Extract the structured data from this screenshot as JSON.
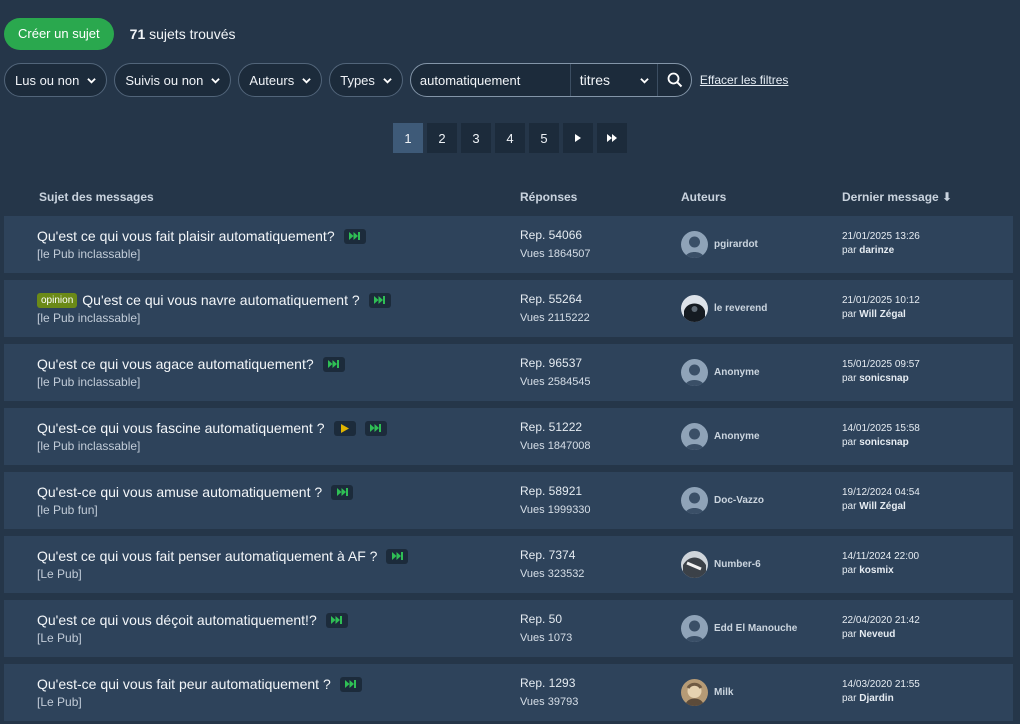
{
  "toolbar": {
    "create_label": "Créer un sujet",
    "count_number": "71",
    "count_suffix": "sujets trouvés"
  },
  "filters": {
    "items": [
      "Lus ou non",
      "Suivis ou non",
      "Auteurs",
      "Types"
    ],
    "search_value": "automatiquement",
    "search_scope": "titres",
    "clear_label": "Effacer les filtres"
  },
  "pager": {
    "pages": [
      "1",
      "2",
      "3",
      "4",
      "5"
    ],
    "current": "1"
  },
  "table": {
    "headers": {
      "subject": "Sujet des messages",
      "replies": "Réponses",
      "authors": "Auteurs",
      "last": "Dernier message ⬇"
    },
    "rows": [
      {
        "tag": "",
        "title": "Qu'est ce qui vous fait plaisir automatiquement?",
        "play": false,
        "forum": "[le Pub inclassable]",
        "replies": "Rep. 54066",
        "views": "Vues 1864507",
        "author": "pgirardot",
        "avatar": "default",
        "date": "21/01/2025 13:26",
        "by_prefix": "par",
        "by": "darinze"
      },
      {
        "tag": "opinion",
        "title": "Qu'est ce qui vous navre automatiquement ?",
        "play": false,
        "forum": "[le Pub inclassable]",
        "replies": "Rep. 55264",
        "views": "Vues 2115222",
        "author": "le reverend",
        "avatar": "dark",
        "date": "21/01/2025 10:12",
        "by_prefix": "par",
        "by": "Will Zégal"
      },
      {
        "tag": "",
        "title": "Qu'est ce qui vous agace automatiquement?",
        "play": false,
        "forum": "[le Pub inclassable]",
        "replies": "Rep. 96537",
        "views": "Vues 2584545",
        "author": "Anonyme",
        "avatar": "default",
        "date": "15/01/2025 09:57",
        "by_prefix": "par",
        "by": "sonicsnap"
      },
      {
        "tag": "",
        "title": "Qu'est-ce qui vous fascine automatiquement ?",
        "play": true,
        "forum": "[le Pub inclassable]",
        "replies": "Rep. 51222",
        "views": "Vues 1847008",
        "author": "Anonyme",
        "avatar": "default",
        "date": "14/01/2025 15:58",
        "by_prefix": "par",
        "by": "sonicsnap"
      },
      {
        "tag": "",
        "title": "Qu'est-ce qui vous amuse automatiquement ?",
        "play": false,
        "forum": "[le Pub fun]",
        "replies": "Rep. 58921",
        "views": "Vues 1999330",
        "author": "Doc-Vazzo",
        "avatar": "default",
        "date": "19/12/2024 04:54",
        "by_prefix": "par",
        "by": "Will Zégal"
      },
      {
        "tag": "",
        "title": "Qu'est ce qui vous fait penser automatiquement à AF ?",
        "play": false,
        "forum": "[Le Pub]",
        "replies": "Rep. 7374",
        "views": "Vues 323532",
        "author": "Number-6",
        "avatar": "mono",
        "date": "14/11/2024 22:00",
        "by_prefix": "par",
        "by": "kosmix"
      },
      {
        "tag": "",
        "title": "Qu'est ce qui vous déçoit automatiquement!?",
        "play": false,
        "forum": "[Le Pub]",
        "replies": "Rep. 50",
        "views": "Vues 1073",
        "author": "Edd El Manouche",
        "avatar": "default",
        "date": "22/04/2020 21:42",
        "by_prefix": "par",
        "by": "Neveud"
      },
      {
        "tag": "",
        "title": "Qu'est-ce qui vous fait peur automatiquement ?",
        "play": false,
        "forum": "[Le Pub]",
        "replies": "Rep. 1293",
        "views": "Vues 39793",
        "author": "Milk",
        "avatar": "photo",
        "date": "14/03/2020 21:55",
        "by_prefix": "par",
        "by": "Djardin"
      }
    ]
  },
  "colors": {
    "background": "#253649",
    "row": "#2e435b",
    "accent": "#2aa84e",
    "tag": "#6b8a17",
    "play": "#e0b400"
  }
}
